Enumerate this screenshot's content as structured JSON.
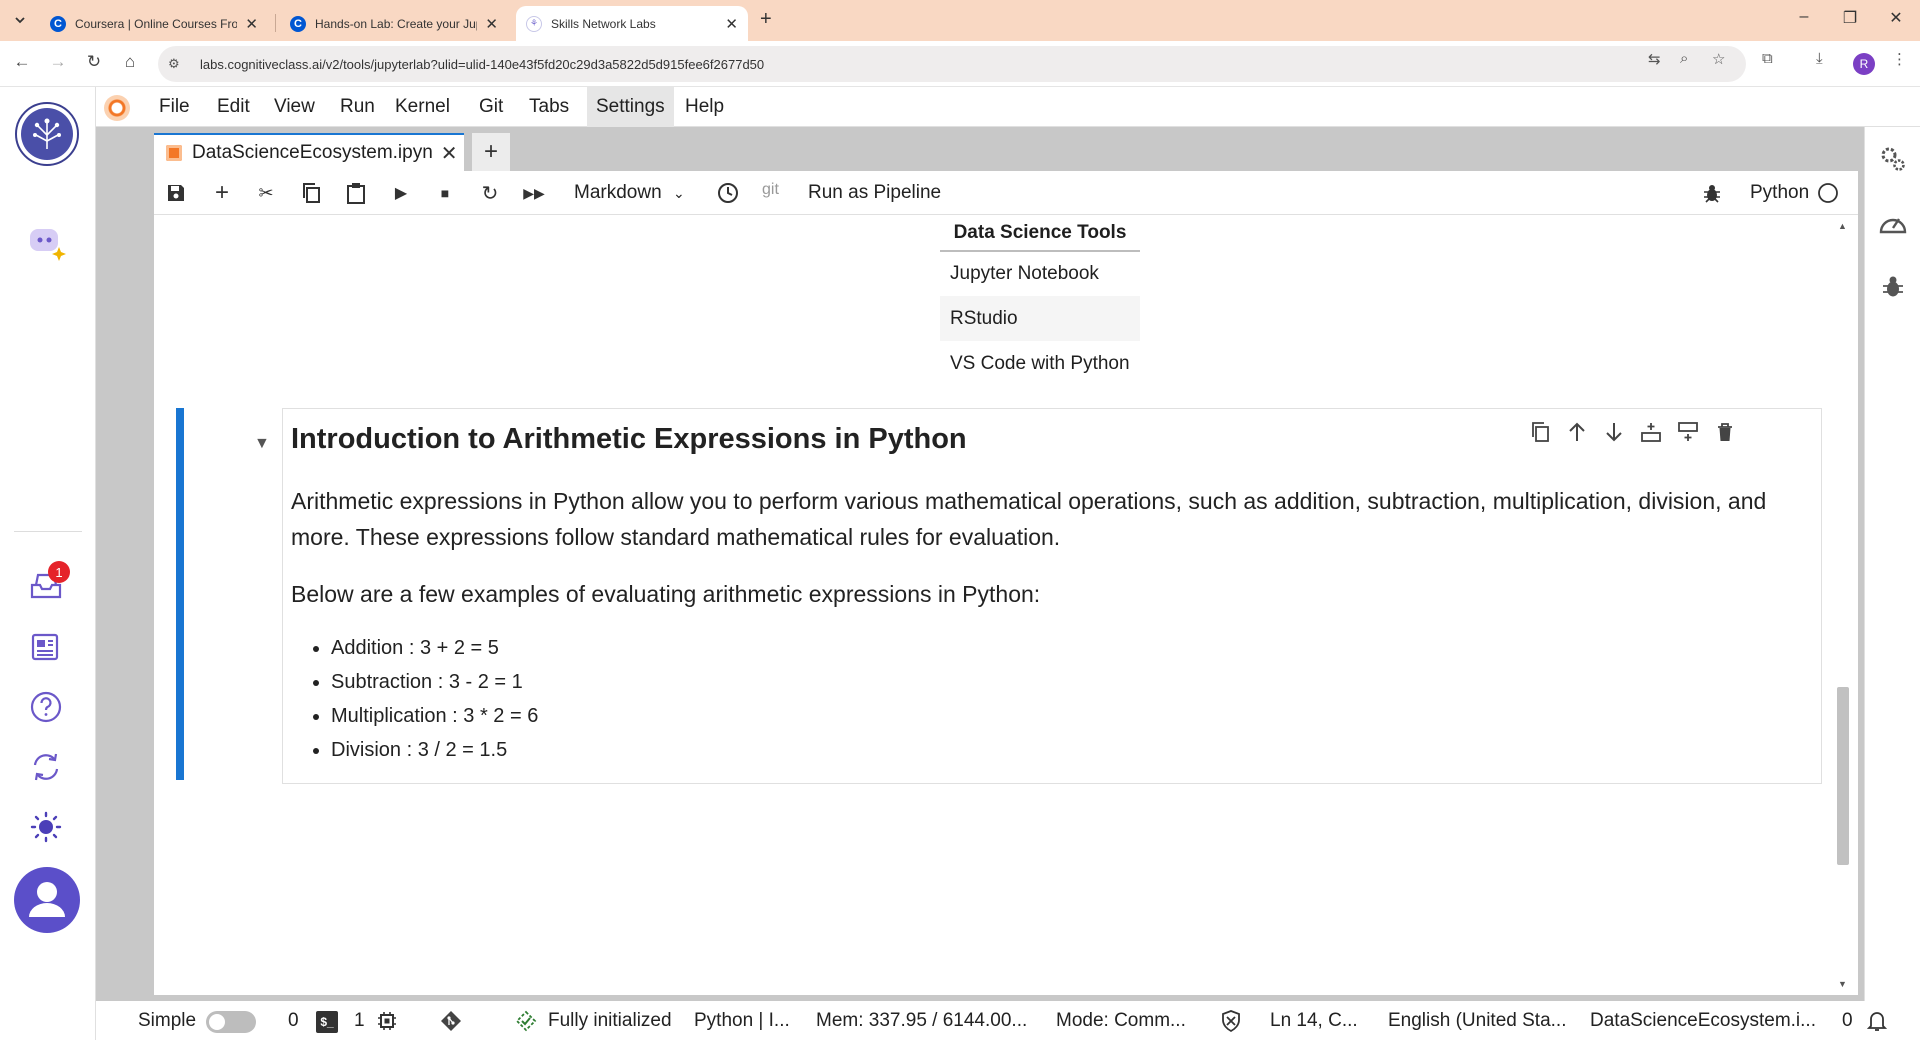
{
  "browser": {
    "tabs": [
      {
        "title": "Coursera | Online Courses From",
        "favicon": "C"
      },
      {
        "title": "Hands-on Lab: Create your Jup",
        "favicon": "C"
      },
      {
        "title": "Skills Network Labs",
        "favicon": "⚘"
      }
    ],
    "new_tab": "+",
    "url": "labs.cognitiveclass.ai/v2/tools/jupyterlab?ulid=ulid-140e43f5fd20c29d3a5822d5d915fee6f2677d50",
    "profile_initial": "R"
  },
  "menubar": {
    "items": [
      "File",
      "Edit",
      "View",
      "Run",
      "Kernel",
      "Git",
      "Tabs",
      "Settings",
      "Help"
    ]
  },
  "left_rail": {
    "notification_count": "1"
  },
  "document": {
    "tab_title": "DataScienceEcosystem.ipyn",
    "add": "+"
  },
  "notebook_toolbar": {
    "cell_type": "Markdown",
    "git": "git",
    "run_pipeline": "Run as Pipeline",
    "kernel": "Python"
  },
  "table": {
    "header": "Data Science Tools",
    "rows": [
      "Jupyter Notebook",
      "RStudio",
      "VS Code with Python"
    ]
  },
  "cell": {
    "heading": "Introduction to Arithmetic Expressions in Python",
    "paragraph1": "Arithmetic expressions in Python allow you to perform various mathematical operations, such as addition, subtraction, multiplication, division, and more. These expressions follow standard mathematical rules for evaluation.",
    "paragraph2": "Below are a few examples of evaluating arithmetic expressions in Python:",
    "list": [
      "Addition : 3 + 2 = 5",
      "Subtraction : 3 - 2 = 1",
      "Multiplication : 3 * 2 = 6",
      "Division : 3 / 2 = 1.5"
    ]
  },
  "statusbar": {
    "mode_label": "Simple",
    "terminals": "0",
    "kernels": "1",
    "kernel_status": "Fully initialized",
    "kernel_name": "Python | I...",
    "memory": "Mem: 337.95 / 6144.00...",
    "mode": "Mode: Comm...",
    "position": "Ln 14, C...",
    "language": "English (United Sta...",
    "file": "DataScienceEcosystem.i...",
    "notifications": "0"
  },
  "colors": {
    "tabstrip": "#f9d8c3",
    "accent": "#1976d2",
    "badge": "#e5232a"
  }
}
